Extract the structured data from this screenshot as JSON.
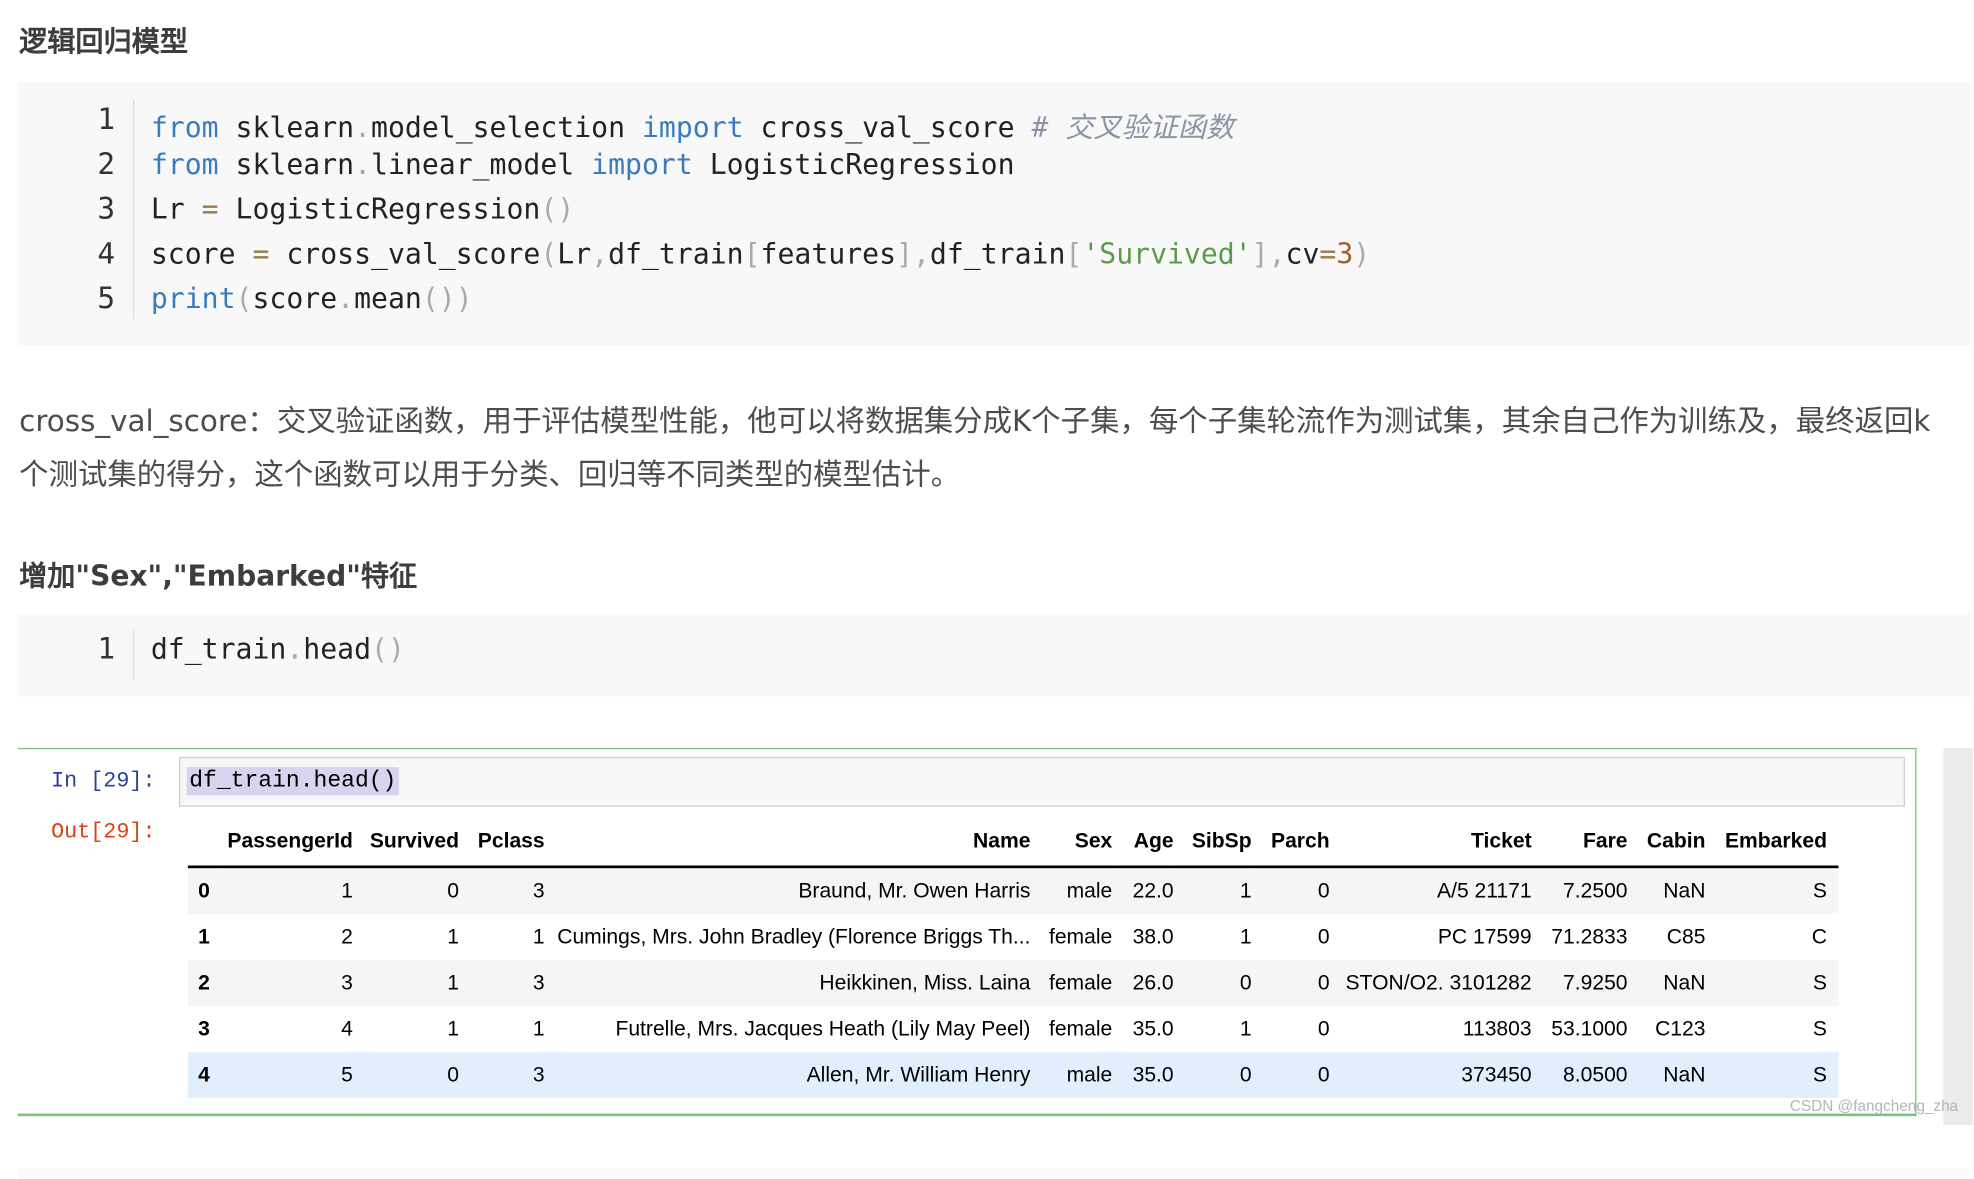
{
  "heading1": "逻辑回归模型",
  "code1": {
    "line_numbers": [
      "1",
      "2",
      "3",
      "4",
      "5"
    ],
    "lines": [
      [
        {
          "t": "from",
          "c": "kw"
        },
        {
          "t": " sklearn"
        },
        {
          "t": ".",
          "c": "pn"
        },
        {
          "t": "model_selection "
        },
        {
          "t": "import",
          "c": "kw"
        },
        {
          "t": " cross_val_score "
        },
        {
          "t": "# 交叉验证函数",
          "c": "cm"
        }
      ],
      [
        {
          "t": "from",
          "c": "kw"
        },
        {
          "t": " sklearn"
        },
        {
          "t": ".",
          "c": "pn"
        },
        {
          "t": "linear_model "
        },
        {
          "t": "import",
          "c": "kw"
        },
        {
          "t": " LogisticRegression"
        }
      ],
      [
        {
          "t": "Lr "
        },
        {
          "t": "=",
          "c": "op"
        },
        {
          "t": " LogisticRegression"
        },
        {
          "t": "()",
          "c": "pn"
        }
      ],
      [
        {
          "t": "score "
        },
        {
          "t": "=",
          "c": "op"
        },
        {
          "t": " cross_val_score"
        },
        {
          "t": "(",
          "c": "pn"
        },
        {
          "t": "Lr"
        },
        {
          "t": ",",
          "c": "pn"
        },
        {
          "t": "df_train"
        },
        {
          "t": "[",
          "c": "pn"
        },
        {
          "t": "features"
        },
        {
          "t": "]",
          "c": "pn"
        },
        {
          "t": ",",
          "c": "pn"
        },
        {
          "t": "df_train"
        },
        {
          "t": "[",
          "c": "pn"
        },
        {
          "t": "'Survived'",
          "c": "st"
        },
        {
          "t": "]",
          "c": "pn"
        },
        {
          "t": ",",
          "c": "pn"
        },
        {
          "t": "cv"
        },
        {
          "t": "=",
          "c": "op"
        },
        {
          "t": "3",
          "c": "nm"
        },
        {
          "t": ")",
          "c": "pn"
        }
      ],
      [
        {
          "t": "print",
          "c": "kw"
        },
        {
          "t": "(",
          "c": "pn"
        },
        {
          "t": "score"
        },
        {
          "t": ".",
          "c": "pn"
        },
        {
          "t": "mean"
        },
        {
          "t": "())",
          "c": "pn"
        }
      ]
    ]
  },
  "paragraph": "cross_val_score：交叉验证函数，用于评估模型性能，他可以将数据集分成K个子集，每个子集轮流作为测试集，其余自己作为训练及，最终返回k个测试集的得分，这个函数可以用于分类、回归等不同类型的模型估计。",
  "heading2": "增加\"Sex\",\"Embarked\"特征",
  "code2": {
    "line_number": "1",
    "lines": [
      [
        {
          "t": "df_train"
        },
        {
          "t": ".",
          "c": "pn"
        },
        {
          "t": "head"
        },
        {
          "t": "()",
          "c": "pn"
        }
      ]
    ]
  },
  "notebook": {
    "in_prompt": "In [29]:",
    "in_code": "df_train.head()",
    "out_prompt": "Out[29]:",
    "columns": [
      "",
      "PassengerId",
      "Survived",
      "Pclass",
      "Name",
      "Sex",
      "Age",
      "SibSp",
      "Parch",
      "Ticket",
      "Fare",
      "Cabin",
      "Embarked"
    ],
    "rows": [
      [
        "0",
        "1",
        "0",
        "3",
        "Braund, Mr. Owen Harris",
        "male",
        "22.0",
        "1",
        "0",
        "A/5 21171",
        "7.2500",
        "NaN",
        "S"
      ],
      [
        "1",
        "2",
        "1",
        "1",
        "Cumings, Mrs. John Bradley (Florence Briggs Th...",
        "female",
        "38.0",
        "1",
        "0",
        "PC 17599",
        "71.2833",
        "C85",
        "C"
      ],
      [
        "2",
        "3",
        "1",
        "3",
        "Heikkinen, Miss. Laina",
        "female",
        "26.0",
        "0",
        "0",
        "STON/O2. 3101282",
        "7.9250",
        "NaN",
        "S"
      ],
      [
        "3",
        "4",
        "1",
        "1",
        "Futrelle, Mrs. Jacques Heath (Lily May Peel)",
        "female",
        "35.0",
        "1",
        "0",
        "113803",
        "53.1000",
        "C123",
        "S"
      ],
      [
        "4",
        "5",
        "0",
        "3",
        "Allen, Mr. William Henry",
        "male",
        "35.0",
        "0",
        "0",
        "373450",
        "8.0500",
        "NaN",
        "S"
      ]
    ],
    "highlighted_row": 4
  },
  "watermark": "CSDN @fangcheng_zha",
  "colors": {
    "in_prompt": "#303f9f",
    "out_prompt": "#d84315",
    "cell_border": "#7cc07c",
    "keyword": "#3a7bbf",
    "string": "#5a9a4a"
  }
}
